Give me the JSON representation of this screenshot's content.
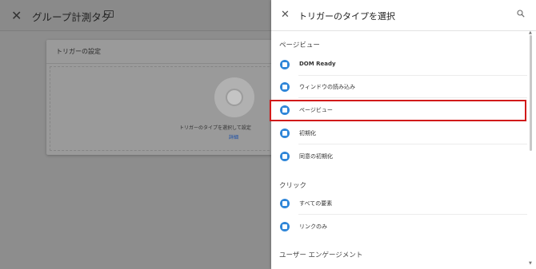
{
  "left": {
    "title": "グループ計測タグ",
    "card_title": "トリガーの設定",
    "hint_text": "トリガーのタイプを選択して設定",
    "hint_link": "詳細"
  },
  "panel": {
    "title": "トリガーのタイプを選択",
    "sections": [
      {
        "label": "ページビュー",
        "items": [
          "DOM Ready",
          "ウィンドウの読み込み",
          "ページビュー",
          "初期化",
          "同意の初期化"
        ]
      },
      {
        "label": "クリック",
        "items": [
          "すべての要素",
          "リンクのみ"
        ]
      },
      {
        "label": "ユーザー エンゲージメント",
        "items": []
      }
    ],
    "highlighted_item": "ページビュー"
  },
  "colors": {
    "accent": "#2f86d8",
    "highlight": "#d11a1a"
  },
  "icons": [
    "close-icon",
    "folder-icon",
    "search-icon",
    "trigger-type-icon"
  ]
}
